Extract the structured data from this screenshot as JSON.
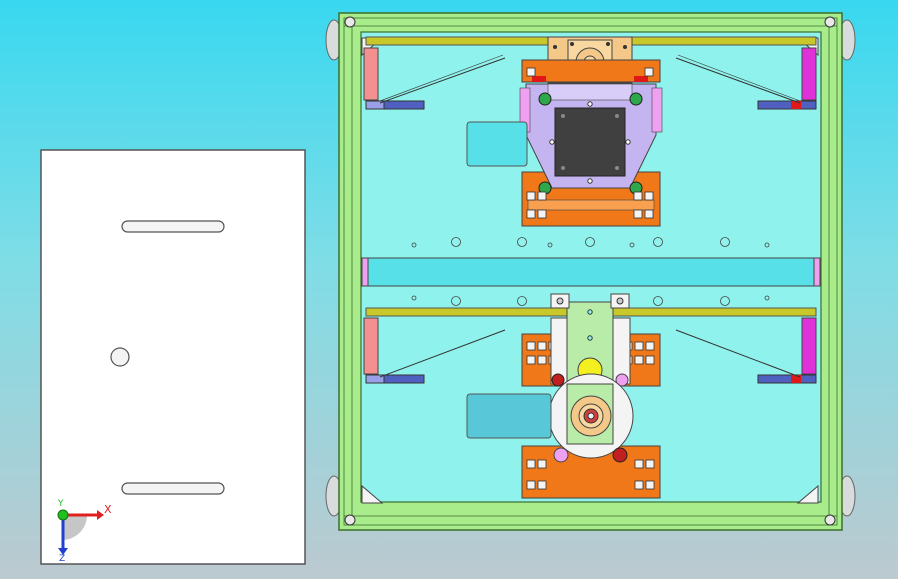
{
  "viewport": {
    "background_top": "#38d8f0",
    "background_bottom": "#bcc9cf"
  },
  "triad": {
    "x_label": "X",
    "y_label": "Y",
    "z_label": "Z",
    "x_color": "#e02020",
    "y_color": "#20c020",
    "z_color": "#2040d0"
  },
  "colors": {
    "frame_green": "#a8ec8c",
    "frame_edge": "#3c6e2c",
    "base_cyan": "#8ff2ec",
    "plate_orange": "#f07818",
    "bracket_lavender": "#c4b4f0",
    "rail_yellow": "#c8c82a",
    "part_pink": "#f0a0f0",
    "dark_plate": "#404040"
  }
}
